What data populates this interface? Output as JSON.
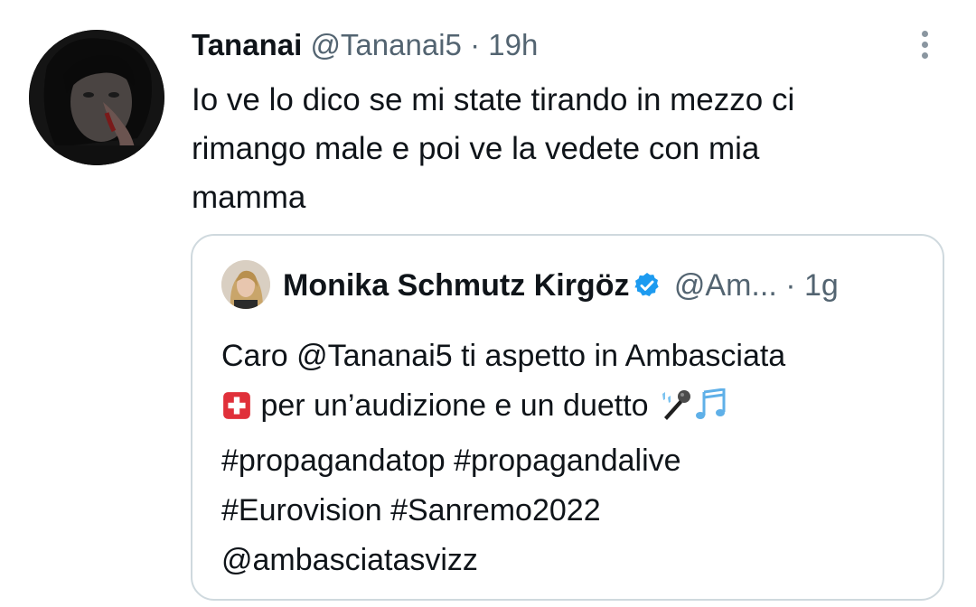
{
  "tweet": {
    "author_name": "Tananai",
    "author_handle": "@Tananai5",
    "separator": "·",
    "time": "19h",
    "text_lines": [
      "Io ve lo dico se mi state tirando in mezzo ci",
      "rimango male e poi ve la vedete con mia",
      "mamma"
    ]
  },
  "quoted": {
    "author_name": "Monika Schmutz Kirgöz",
    "author_handle": "@Am...",
    "separator": "·",
    "time": "1g",
    "line1": "Caro @Tananai5 ti aspetto in Ambasciata",
    "line2": "per un’audizione e un duetto",
    "line3": "#propagandatop #propagandalive",
    "line4": "#Eurovision #Sanremo2022",
    "line5": "@ambasciatasvizz"
  },
  "icons": {
    "more": "more-vertical-icon",
    "verified": "verified-badge-icon",
    "swiss_flag": "swiss-flag-emoji",
    "microphone": "microphone-emoji",
    "notes": "musical-notes-emoji"
  },
  "colors": {
    "verified": "#1d9bf0",
    "secondary_text": "#536471",
    "border": "#cfd9de",
    "flag_red": "#e0303a"
  }
}
